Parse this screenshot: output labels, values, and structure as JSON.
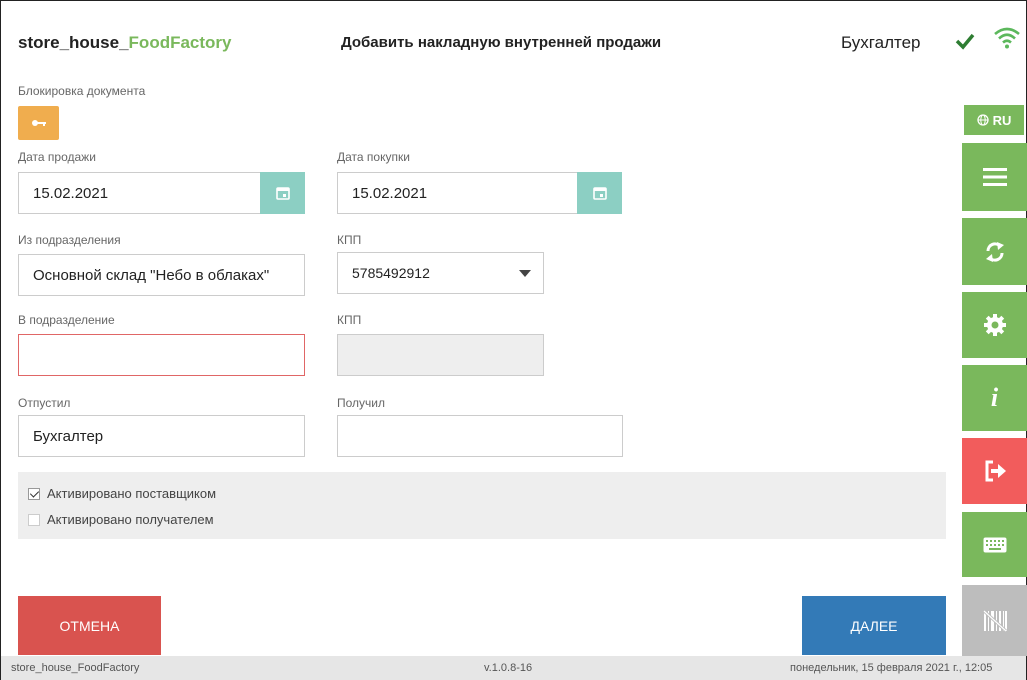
{
  "header": {
    "app_name_prefix": "store_house_",
    "app_name_accent": "FoodFactory",
    "page_title": "Добавить накладную внутренней продажи",
    "user": "Бухгалтер"
  },
  "form": {
    "lock_label": "Блокировка документа",
    "sale_date_label": "Дата продажи",
    "sale_date_value": "15.02.2021",
    "purchase_date_label": "Дата покупки",
    "purchase_date_value": "15.02.2021",
    "from_division_label": "Из подразделения",
    "from_division_value": "Основной склад \"Небо в облаках\"",
    "kpp1_label": "КПП",
    "kpp1_value": "5785492912",
    "to_division_label": "В подразделение",
    "to_division_value": "",
    "kpp2_label": "КПП",
    "kpp2_value": "",
    "released_label": "Отпустил",
    "released_value": "Бухгалтер",
    "received_label": "Получил",
    "received_value": "",
    "activated_supplier_label": "Активировано поставщиком",
    "activated_supplier_checked": true,
    "activated_recipient_label": "Активировано получателем",
    "activated_recipient_checked": false
  },
  "buttons": {
    "cancel": "ОТМЕНА",
    "next": "ДАЛЕЕ"
  },
  "sidebar": {
    "lang": "RU",
    "items": [
      "menu-icon",
      "sync-icon",
      "gear-icon",
      "info-icon",
      "logout-icon",
      "keyboard-icon",
      "barcode-icon"
    ]
  },
  "footer": {
    "app": "store_house_FoodFactory",
    "version": "v.1.0.8-16",
    "datetime": "понедельник, 15 февраля 2021 г., 12:05"
  },
  "colors": {
    "accent_green": "#7ab85c",
    "lock_orange": "#f0ad4e",
    "calendar_teal": "#8ccfc3",
    "cancel_red": "#d9534f",
    "next_blue": "#337ab7",
    "logout_red": "#f25c5c"
  }
}
